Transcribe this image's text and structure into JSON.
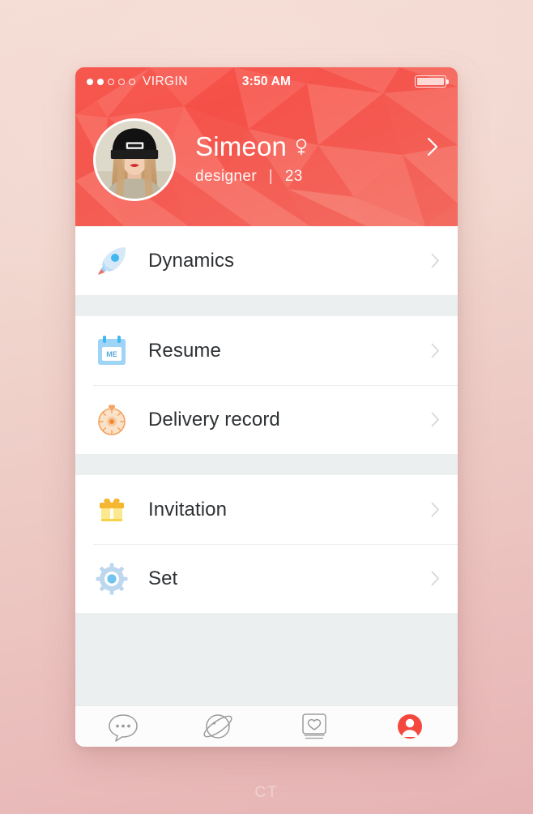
{
  "watermark": "CT",
  "status_bar": {
    "carrier": "VIRGIN",
    "time": "3:50 AM",
    "signal_dots_filled": 2,
    "signal_dots_total": 5,
    "battery_full": true
  },
  "profile": {
    "name": "Simeon",
    "gender_icon": "female-symbol-icon",
    "occupation": "designer",
    "separator": "|",
    "age": "23",
    "avatar_icon": "user-avatar-photo",
    "chevron_icon": "chevron-right-icon"
  },
  "menu_groups": [
    {
      "items": [
        {
          "label": "Dynamics",
          "icon": "rocket-icon",
          "chevron": "chevron-right-icon"
        }
      ]
    },
    {
      "items": [
        {
          "label": "Resume",
          "icon": "calendar-me-icon",
          "icon_text": "ME",
          "chevron": "chevron-right-icon"
        },
        {
          "label": "Delivery record",
          "icon": "stopwatch-icon",
          "chevron": "chevron-right-icon"
        }
      ]
    },
    {
      "items": [
        {
          "label": "Invitation",
          "icon": "gift-box-icon",
          "chevron": "chevron-right-icon"
        },
        {
          "label": "Set",
          "icon": "gear-icon",
          "chevron": "chevron-right-icon"
        }
      ]
    }
  ],
  "tabbar": {
    "tabs": [
      {
        "label": "message",
        "icon": "speech-bubble-icon",
        "active": false
      },
      {
        "label": "found",
        "icon": "planet-icon",
        "active": false
      },
      {
        "label": "pair",
        "icon": "heart-cards-icon",
        "active": false
      },
      {
        "label": "me",
        "icon": "person-circle-icon",
        "active": true
      }
    ]
  },
  "colors": {
    "header_red": "#f5594f",
    "accent_red": "#f4554c",
    "list_bg": "#eceff0",
    "text_dark": "#2e3134",
    "tab_inactive": "#a9a9a9",
    "rocket_blue": "#3fb8f0",
    "calendar_blue": "#9ed4f5",
    "stopwatch_orange": "#f2a361",
    "gift_gold": "#f5b731",
    "gear_blue": "#bcd7ee"
  }
}
